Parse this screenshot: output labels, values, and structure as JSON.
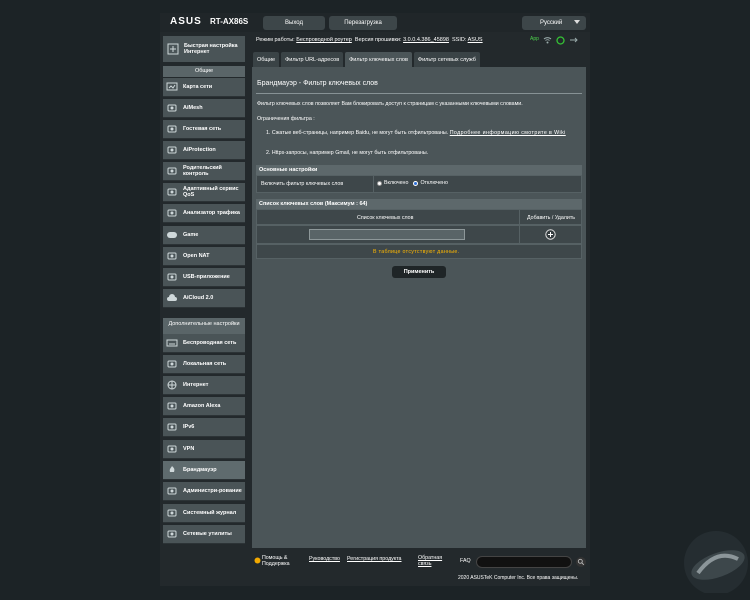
{
  "header": {
    "logo": "ASUS",
    "model": "RT-AX86S",
    "logout": "Выход",
    "reboot": "Перезагрузка",
    "language": "Русский"
  },
  "sidebar": {
    "quick_setup": "Быстрая настройка Интернет",
    "general_title": "Общие",
    "general_items": [
      {
        "label": "Карта сети",
        "icon": "network-map-icon"
      },
      {
        "label": "AiMesh",
        "icon": "aimesh-icon"
      },
      {
        "label": "Гостевая сеть",
        "icon": "guest-network-icon"
      },
      {
        "label": "AiProtection",
        "icon": "aiprotection-icon"
      },
      {
        "label": "Родительский контроль",
        "icon": "parental-control-icon"
      },
      {
        "label": "Адаптивный сервис QoS",
        "icon": "qos-icon"
      },
      {
        "label": "Анализатор трафика",
        "icon": "traffic-analyzer-icon"
      },
      {
        "label": "Game",
        "icon": "gamepad-icon"
      },
      {
        "label": "Open NAT",
        "icon": "open-nat-icon"
      },
      {
        "label": "USB-приложение",
        "icon": "usb-icon"
      },
      {
        "label": "AiCloud 2.0",
        "icon": "cloud-icon"
      }
    ],
    "advanced_title": "Дополнительные настройки",
    "advanced_items": [
      {
        "label": "Беспроводная сеть",
        "icon": "wifi-icon"
      },
      {
        "label": "Локальная сеть",
        "icon": "lan-icon"
      },
      {
        "label": "Интернет",
        "icon": "globe-icon"
      },
      {
        "label": "Amazon Alexa",
        "icon": "alexa-icon"
      },
      {
        "label": "IPv6",
        "icon": "ipv6-icon"
      },
      {
        "label": "VPN",
        "icon": "vpn-icon"
      },
      {
        "label": "Брандмауэр",
        "icon": "firewall-icon",
        "active": true
      },
      {
        "label": "Администри-рование",
        "icon": "admin-icon"
      },
      {
        "label": "Системный журнал",
        "icon": "system-log-icon"
      },
      {
        "label": "Сетевые утилиты",
        "icon": "network-tools-icon"
      }
    ]
  },
  "status": {
    "mode_label": "Режим работы:",
    "mode_value": "Беспроводной роутер",
    "firmware_label": "Версия прошивки:",
    "firmware_value": "3.0.0.4.386_45898",
    "ssid_label": "SSID:",
    "ssid_value": "ASUS",
    "app_label": "App"
  },
  "tabs": [
    "Общие",
    "Фильтр URL-адресов",
    "Фильтр ключевых слов",
    "Фильтр сетевых служб"
  ],
  "page": {
    "title": "Брандмауэр - Фильтр ключевых слов",
    "description": "Фильтр ключевых слов позволяет Вам блокировать доступ к страницам с указанными ключевыми словами.",
    "limits_title": "Ограничения фильтра :",
    "limit1_prefix": "1. Сжатые веб-страницы, например Baidu, не могут быть отфильтрованы.",
    "limit1_link": "Подробнее информацию смотрите в Wiki",
    "limit2": "2. Https-запросы, например Gmail, не могут быть отфильтрованы."
  },
  "basic": {
    "section_title": "Основные настройки",
    "enable_label": "Включить фильтр ключевых слов",
    "opt_on": "Включено",
    "opt_off": "Отключено"
  },
  "list": {
    "section_title": "Список ключевых слов (Максимум : 64)",
    "col_keywords": "Список ключевых слов",
    "col_action": "Добавить / Удалить",
    "empty_text": "В таблице отсутствуют данные."
  },
  "apply": "Применить",
  "footer": {
    "help": "Помощь & Поддержка",
    "manual": "Руководство",
    "register": "Регистрация продукта",
    "feedback": "Обратная связь",
    "faq": "FAQ",
    "copyright": "2020 ASUSTeK Computer Inc. Все права защищены."
  },
  "colors": {
    "background": "#1c2326",
    "panel": "#4b5558",
    "accent_text": "#ffb800"
  }
}
